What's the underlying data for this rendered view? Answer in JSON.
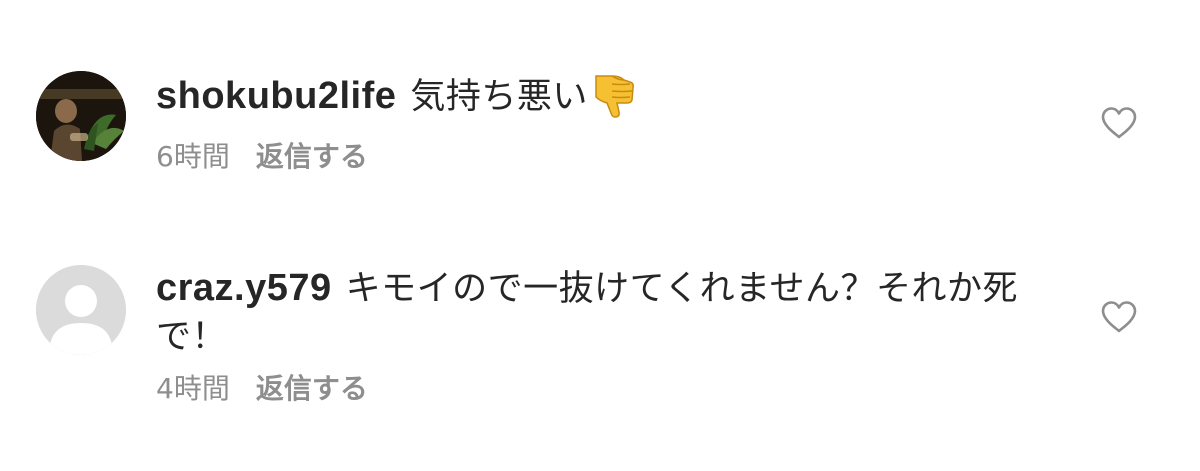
{
  "comments": [
    {
      "username": "shokubu2life",
      "text": "気持ち悪い",
      "emoji": "thumbs-down-icon",
      "time": "6時間",
      "reply_label": "返信する",
      "avatar": "profile-photo"
    },
    {
      "username": "craz.y579",
      "text": "キモイので一抜けてくれません？それか死で！",
      "time": "4時間",
      "reply_label": "返信する",
      "avatar": "default-avatar-icon"
    }
  ],
  "colors": {
    "text": "#262626",
    "meta": "#8e8e8e",
    "heart_stroke": "#8e8e8e",
    "default_avatar_bg": "#dbdbdb",
    "emoji_yellow": "#f6c033"
  }
}
